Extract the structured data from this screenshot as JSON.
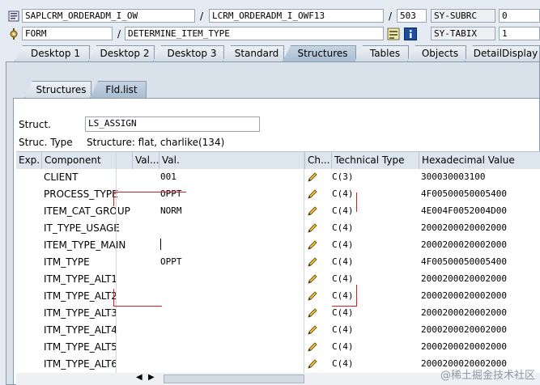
{
  "header": {
    "row1": {
      "program": "SAPLCRM_ORDERADM_I_OW",
      "separator": "/",
      "include": "LCRM_ORDERADM_I_OWF13",
      "separator2": "/",
      "line": "503",
      "sysvar_name": "SY-SUBRC",
      "sysvar_value": "0"
    },
    "row2": {
      "event_type": "FORM",
      "separator": "/",
      "event_name": "DETERMINE_ITEM_TYPE",
      "sysvar_name": "SY-TABIX",
      "sysvar_value": "1"
    }
  },
  "tabs": [
    "Desktop 1",
    "Desktop 2",
    "Desktop 3",
    "Standard",
    "Structures",
    "Tables",
    "Objects",
    "DetailDisplay"
  ],
  "active_tab": "Structures",
  "subtabs": [
    "Structures",
    "Fld.list"
  ],
  "active_subtab": "Fld.list",
  "struct": {
    "label": "Struct.",
    "value": "LS_ASSIGN",
    "type_label": "Struc. Type",
    "type_value": "Structure: flat, charlike(134)"
  },
  "table": {
    "columns": [
      "Exp.",
      "Component",
      "Val...",
      "Val.",
      "Ch...",
      "Technical Type",
      "Hexadecimal Value"
    ],
    "rows": [
      {
        "component": "CLIENT",
        "val": "001",
        "tech": "C(3)",
        "hex": "300030003100"
      },
      {
        "component": "PROCESS_TYPE",
        "val": "OPPT",
        "tech": "C(4)",
        "hex": "4F00500050005400"
      },
      {
        "component": "ITEM_CAT_GROUP",
        "val": "NORM",
        "tech": "C(4)",
        "hex": "4E004F0052004D00"
      },
      {
        "component": "IT_TYPE_USAGE",
        "val": "",
        "tech": "C(4)",
        "hex": "2000200020002000"
      },
      {
        "component": "ITEM_TYPE_MAIN",
        "val": "",
        "tech": "C(4)",
        "hex": "2000200020002000"
      },
      {
        "component": "ITM_TYPE",
        "val": "OPPT",
        "tech": "C(4)",
        "hex": "4F00500050005400"
      },
      {
        "component": "ITM_TYPE_ALT1",
        "val": "",
        "tech": "C(4)",
        "hex": "2000200020002000"
      },
      {
        "component": "ITM_TYPE_ALT2",
        "val": "",
        "tech": "C(4)",
        "hex": "2000200020002000"
      },
      {
        "component": "ITM_TYPE_ALT3",
        "val": "",
        "tech": "C(4)",
        "hex": "2000200020002000"
      },
      {
        "component": "ITM_TYPE_ALT4",
        "val": "",
        "tech": "C(4)",
        "hex": "2000200020002000"
      },
      {
        "component": "ITM_TYPE_ALT5",
        "val": "",
        "tech": "C(4)",
        "hex": "2000200020002000"
      },
      {
        "component": "ITM_TYPE_ALT6",
        "val": "",
        "tech": "C(4)",
        "hex": "2000200020002000"
      }
    ]
  },
  "watermark": "@稀土掘金技术社区",
  "colors": {
    "annotation_red": "#d42020",
    "active_tab": "#b3c5d8",
    "panel_bg": "#d9e1ea"
  }
}
